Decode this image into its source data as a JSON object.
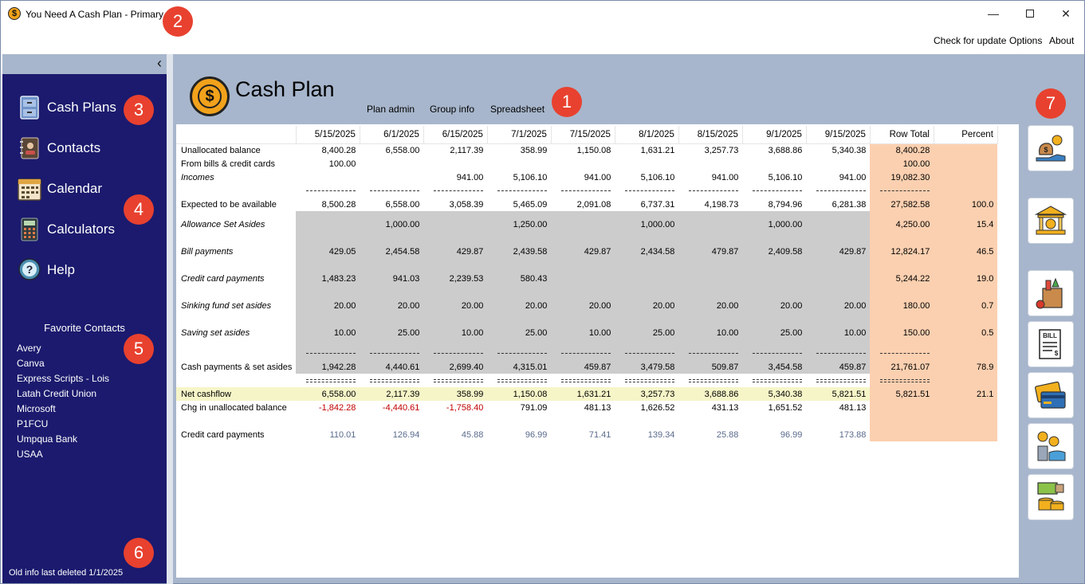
{
  "window": {
    "title": "You Need A Cash Plan - Primary",
    "app_icon": "$",
    "minimize_glyph": "—",
    "close_glyph": "✕"
  },
  "menu": {
    "check_update": "Check for update",
    "options": "Options",
    "about": "About"
  },
  "sidebar": {
    "collapse_glyph": "‹",
    "nav": [
      {
        "label": "Cash Plans",
        "icon": "file-cabinet-icon"
      },
      {
        "label": "Contacts",
        "icon": "address-book-icon"
      },
      {
        "label": "Calendar",
        "icon": "calendar-icon"
      },
      {
        "label": "Calculators",
        "icon": "calculator-icon"
      },
      {
        "label": "Help",
        "icon": "help-icon"
      }
    ],
    "favorites_title": "Favorite Contacts",
    "favorites": [
      "Avery",
      "Canva",
      "Express Scripts - Lois",
      "Latah Credit Union",
      "Microsoft",
      "P1FCU",
      "Umpqua Bank",
      "USAA"
    ],
    "old_info": "Old info last deleted 1/1/2025"
  },
  "header": {
    "logo_symbol": "$",
    "title": "Cash Plan",
    "tabs": [
      "Plan admin",
      "Group info",
      "Spreadsheet"
    ]
  },
  "callouts": [
    "1",
    "2",
    "3",
    "4",
    "5",
    "6",
    "7"
  ],
  "sheet": {
    "columns": [
      "5/15/2025",
      "6/1/2025",
      "6/15/2025",
      "7/1/2025",
      "7/15/2025",
      "8/1/2025",
      "8/15/2025",
      "9/1/2025",
      "9/15/2025",
      "Row Total",
      "Percent"
    ],
    "separator_single": "-------------------",
    "separator_double": "===========",
    "rows": {
      "unallocated": {
        "label": "Unallocated balance",
        "values": [
          "8,400.28",
          "6,558.00",
          "2,117.39",
          "358.99",
          "1,150.08",
          "1,631.21",
          "3,257.73",
          "3,688.86",
          "5,340.38",
          "8,400.28",
          ""
        ]
      },
      "from_bills": {
        "label": "From bills & credit cards",
        "values": [
          "100.00",
          "",
          "",
          "",
          "",
          "",
          "",
          "",
          "",
          "100.00",
          ""
        ]
      },
      "incomes": {
        "label": "Incomes",
        "values": [
          "",
          "",
          "941.00",
          "5,106.10",
          "941.00",
          "5,106.10",
          "941.00",
          "5,106.10",
          "941.00",
          "19,082.30",
          ""
        ]
      },
      "expected": {
        "label": "Expected to be available",
        "values": [
          "8,500.28",
          "6,558.00",
          "3,058.39",
          "5,465.09",
          "2,091.08",
          "6,737.31",
          "4,198.73",
          "8,794.96",
          "6,281.38",
          "27,582.58",
          "100.0"
        ]
      },
      "allowance": {
        "label": "Allowance Set Asides",
        "values": [
          "",
          "1,000.00",
          "",
          "1,250.00",
          "",
          "1,000.00",
          "",
          "1,000.00",
          "",
          "4,250.00",
          "15.4"
        ]
      },
      "bills": {
        "label": "Bill payments",
        "values": [
          "429.05",
          "2,454.58",
          "429.87",
          "2,439.58",
          "429.87",
          "2,434.58",
          "479.87",
          "2,409.58",
          "429.87",
          "12,824.17",
          "46.5"
        ]
      },
      "credit": {
        "label": "Credit card payments",
        "values": [
          "1,483.23",
          "941.03",
          "2,239.53",
          "580.43",
          "",
          "",
          "",
          "",
          "",
          "5,244.22",
          "19.0"
        ]
      },
      "sinking": {
        "label": "Sinking fund set asides",
        "values": [
          "20.00",
          "20.00",
          "20.00",
          "20.00",
          "20.00",
          "20.00",
          "20.00",
          "20.00",
          "20.00",
          "180.00",
          "0.7"
        ]
      },
      "saving": {
        "label": "Saving set asides",
        "values": [
          "10.00",
          "25.00",
          "10.00",
          "25.00",
          "10.00",
          "25.00",
          "10.00",
          "25.00",
          "10.00",
          "150.00",
          "0.5"
        ]
      },
      "cash_payments": {
        "label": "Cash payments & set asides",
        "values": [
          "1,942.28",
          "4,440.61",
          "2,699.40",
          "4,315.01",
          "459.87",
          "3,479.58",
          "509.87",
          "3,454.58",
          "459.87",
          "21,761.07",
          "78.9"
        ]
      },
      "net": {
        "label": "Net cashflow",
        "values": [
          "6,558.00",
          "2,117.39",
          "358.99",
          "1,150.08",
          "1,631.21",
          "3,257.73",
          "3,688.86",
          "5,340.38",
          "5,821.51",
          "5,821.51",
          "21.1"
        ]
      },
      "chg": {
        "label": "Chg in unallocated balance",
        "values": [
          "-1,842.28",
          "-4,440.61",
          "-1,758.40",
          "791.09",
          "481.13",
          "1,626.52",
          "431.13",
          "1,651.52",
          "481.13",
          "",
          ""
        ]
      },
      "cc_info": {
        "label": "Credit card payments",
        "values": [
          "110.01",
          "126.94",
          "45.88",
          "96.99",
          "71.41",
          "139.34",
          "25.88",
          "96.99",
          "173.88",
          "",
          ""
        ]
      }
    }
  },
  "right_tools": [
    {
      "name": "income-money-bags-icon"
    },
    {
      "name": "bank-icon"
    },
    {
      "name": "groceries-icon"
    },
    {
      "name": "bill-icon"
    },
    {
      "name": "credit-card-icon"
    },
    {
      "name": "sinking-fund-icon"
    },
    {
      "name": "savings-coins-icon"
    }
  ],
  "colors": {
    "sidebar": "#1b1a6e",
    "panel": "#a7b6cc",
    "callout": "#e8412f",
    "gray_cell": "#cccccc",
    "peach_cell": "#fbd0b0",
    "net_row": "#f6f5c8",
    "negative": "#c00000"
  }
}
